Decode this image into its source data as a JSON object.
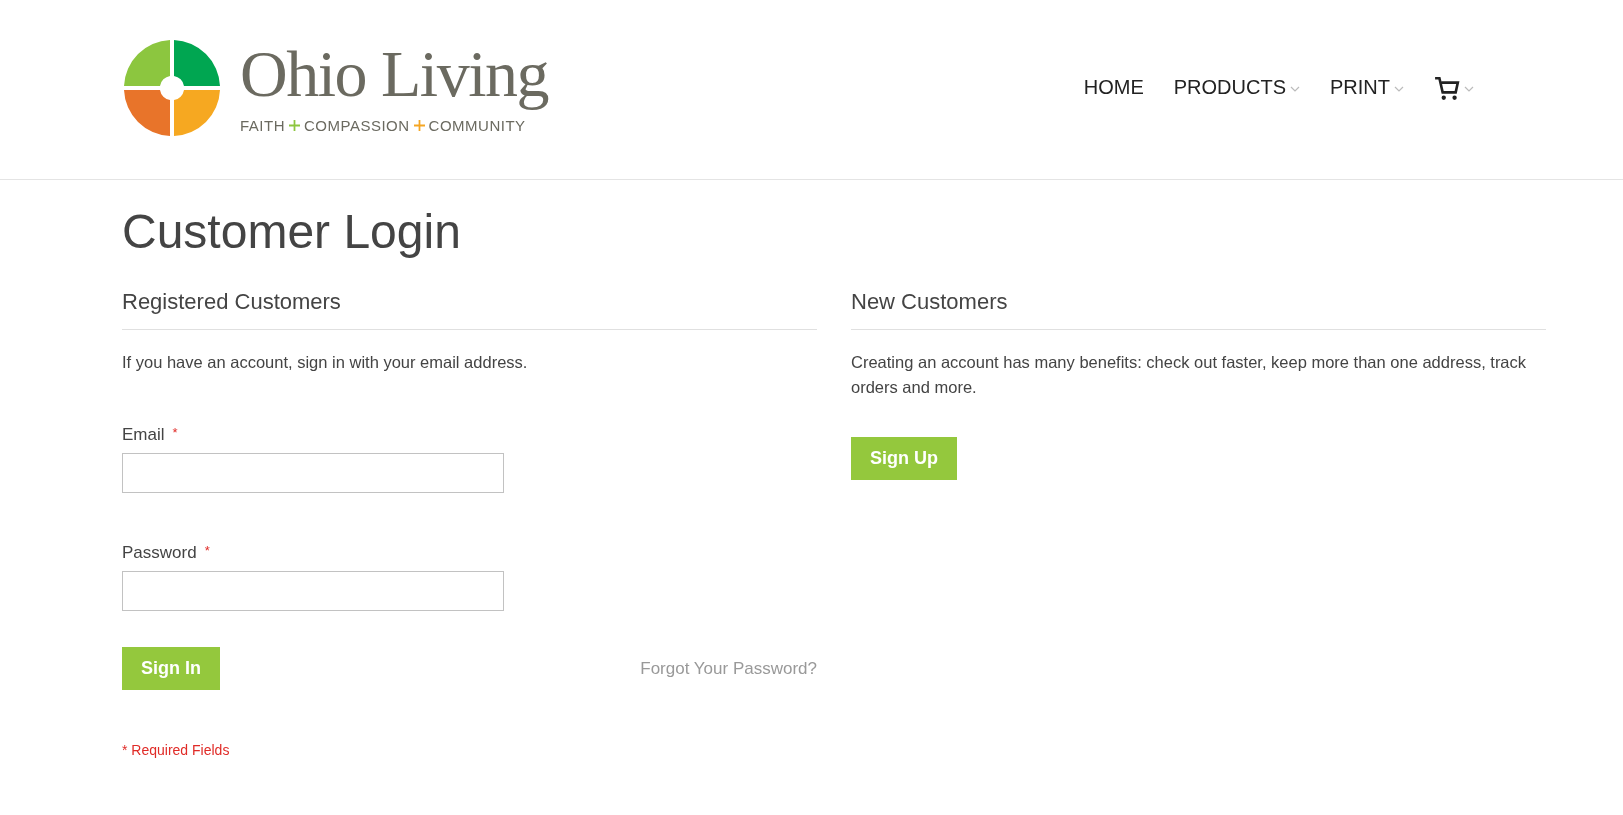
{
  "logo": {
    "name": "Ohio Living",
    "tagline": [
      "FAITH",
      "COMPASSION",
      "COMMUNITY"
    ]
  },
  "nav": [
    {
      "label": "HOME",
      "has_menu": false
    },
    {
      "label": "PRODUCTS",
      "has_menu": true
    },
    {
      "label": "PRINT",
      "has_menu": true
    },
    {
      "kind": "cart",
      "has_menu": true
    }
  ],
  "page_title": "Customer Login",
  "registered": {
    "heading": "Registered Customers",
    "intro": "If you have an account, sign in with your email address.",
    "fields": [
      {
        "label": "Email",
        "required_mark": "*"
      },
      {
        "label": "Password",
        "required_mark": "*"
      }
    ],
    "button": "Sign In",
    "forgot_link": "Forgot Your Password?",
    "required_note": "* Required Fields"
  },
  "new_customers": {
    "heading": "New Customers",
    "intro": "Creating an account has many benefits: check out faster, keep more than one address, track orders and more.",
    "button": "Sign Up"
  }
}
